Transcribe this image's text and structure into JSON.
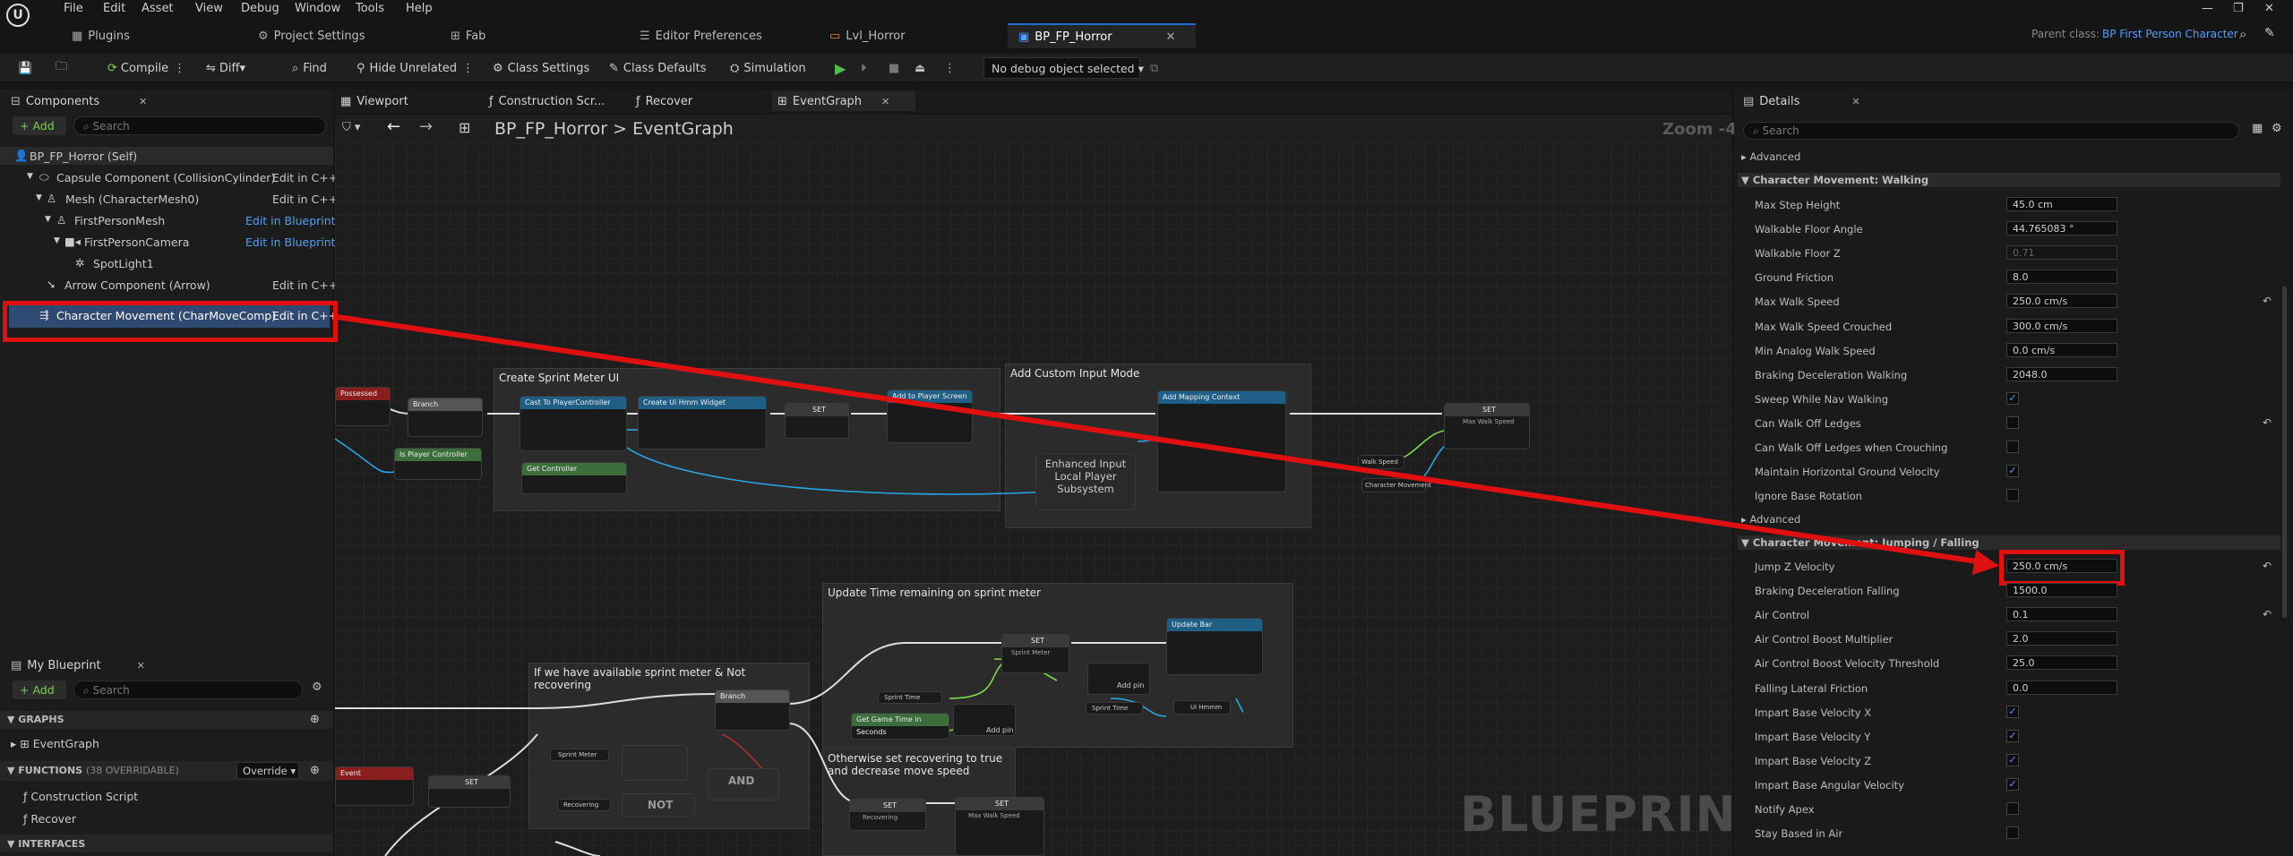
{
  "menu": [
    "File",
    "Edit",
    "Asset",
    "View",
    "Debug",
    "Window",
    "Tools",
    "Help"
  ],
  "doc_tabs": [
    "Plugins",
    "Project Settings",
    "Fab",
    "Editor Preferences",
    "Lvl_Horror",
    "BP_FP_Horror"
  ],
  "parent_class_label": "Parent class:",
  "parent_class": "BP First Person Character",
  "toolbar": {
    "compile": "Compile",
    "diff": "Diff",
    "find": "Find",
    "hide_unrelated": "Hide Unrelated",
    "class_settings": "Class Settings",
    "class_defaults": "Class Defaults",
    "simulation": "Simulation",
    "debug_object": "No debug object selected"
  },
  "components": {
    "tab": "Components",
    "add": "+ Add",
    "search": "Search",
    "items": [
      {
        "label": "BP_FP_Horror (Self)",
        "action": ""
      },
      {
        "label": "Capsule Component (CollisionCylinder)",
        "action": "Edit in C++"
      },
      {
        "label": "Mesh (CharacterMesh0)",
        "action": "Edit in C++"
      },
      {
        "label": "FirstPersonMesh",
        "action": "Edit in Blueprint"
      },
      {
        "label": "FirstPersonCamera",
        "action": "Edit in Blueprint"
      },
      {
        "label": "SpotLight1",
        "action": ""
      },
      {
        "label": "Arrow Component (Arrow)",
        "action": "Edit in C++"
      },
      {
        "label": "Character Movement (CharMoveComp)",
        "action": "Edit in C++"
      }
    ]
  },
  "my_blueprint": {
    "tab": "My Blueprint",
    "add": "+ Add",
    "search": "Search",
    "graphs": "GRAPHS",
    "event_graph": "EventGraph",
    "functions": "FUNCTIONS",
    "functions_count": "(38 OVERRIDABLE)",
    "override": "Override",
    "construction_script": "Construction Script",
    "recover": "Recover",
    "interfaces": "INTERFACES"
  },
  "graph_tabs": [
    "Viewport",
    "Construction Scr...",
    "Recover",
    "EventGraph"
  ],
  "breadcrumb": {
    "root": "BP_FP_Horror",
    "sep": ">",
    "current": "EventGraph"
  },
  "zoom": "Zoom -4",
  "watermark": "BLUEPRINT",
  "comments": [
    "Create Sprint Meter UI",
    "Add Custom Input Mode",
    "Update Time remaining on sprint meter",
    "If we have available sprint meter & Not recovering",
    "Otherwise set recovering to true and decrease move speed"
  ],
  "nodes": {
    "possessed": "Possessed",
    "branch": "Branch",
    "cast": "Cast To PlayerController",
    "create_widget": "Create Ui Hmm Widget",
    "set": "SET",
    "add_to_player_screen": "Add to Player Screen",
    "is_player_controller": "Is Player Controller",
    "get_controller": "Get Controller",
    "add_mapping_context": "Add Mapping Context",
    "enhanced_input": "Enhanced Input Local Player Subsystem",
    "walk_speed": "Walk Speed",
    "character_movement": "Character Movement",
    "max_walk_speed": "Max Walk Speed",
    "update_bar": "Update Bar",
    "add_pin": "Add pin",
    "and": "AND",
    "not": "NOT",
    "get_game_time": "Get Game Time in Seconds",
    "sprint_meter": "Sprint Meter",
    "sprint_time": "Sprint Time",
    "recovering": "Recovering",
    "event": "Event",
    "ui_hmm": "Ui Hmmm"
  },
  "details": {
    "tab": "Details",
    "search": "Search",
    "advanced": "Advanced",
    "section_walking": "Character Movement: Walking",
    "walking": [
      {
        "label": "Max Step Height",
        "value": "45.0 cm",
        "type": "num"
      },
      {
        "label": "Walkable Floor Angle",
        "value": "44.765083 °",
        "type": "num"
      },
      {
        "label": "Walkable Floor Z",
        "value": "0.71",
        "type": "dim"
      },
      {
        "label": "Ground Friction",
        "value": "8.0",
        "type": "num"
      },
      {
        "label": "Max Walk Speed",
        "value": "250.0 cm/s",
        "type": "num",
        "reset": true
      },
      {
        "label": "Max Walk Speed Crouched",
        "value": "300.0 cm/s",
        "type": "num"
      },
      {
        "label": "Min Analog Walk Speed",
        "value": "0.0 cm/s",
        "type": "num"
      },
      {
        "label": "Braking Deceleration Walking",
        "value": "2048.0",
        "type": "num"
      },
      {
        "label": "Sweep While Nav Walking",
        "value": "✓",
        "type": "chk"
      },
      {
        "label": "Can Walk Off Ledges",
        "value": "",
        "type": "chk",
        "reset": true
      },
      {
        "label": "Can Walk Off Ledges when Crouching",
        "value": "",
        "type": "chk"
      },
      {
        "label": "Maintain Horizontal Ground Velocity",
        "value": "✓",
        "type": "chk"
      },
      {
        "label": "Ignore Base Rotation",
        "value": "",
        "type": "chk"
      }
    ],
    "section_jumping": "Character Movement: Jumping / Falling",
    "jumping": [
      {
        "label": "Jump Z Velocity",
        "value": "250.0 cm/s",
        "type": "num",
        "reset": true
      },
      {
        "label": "Braking Deceleration Falling",
        "value": "1500.0",
        "type": "num"
      },
      {
        "label": "Air Control",
        "value": "0.1",
        "type": "num",
        "reset": true
      },
      {
        "label": "Air Control Boost Multiplier",
        "value": "2.0",
        "type": "num"
      },
      {
        "label": "Air Control Boost Velocity Threshold",
        "value": "25.0",
        "type": "num"
      },
      {
        "label": "Falling Lateral Friction",
        "value": "0.0",
        "type": "num"
      },
      {
        "label": "Impart Base Velocity X",
        "value": "✓",
        "type": "chk"
      },
      {
        "label": "Impart Base Velocity Y",
        "value": "✓",
        "type": "chk"
      },
      {
        "label": "Impart Base Velocity Z",
        "value": "✓",
        "type": "chk"
      },
      {
        "label": "Impart Base Angular Velocity",
        "value": "✓",
        "type": "chk"
      },
      {
        "label": "Notify Apex",
        "value": "",
        "type": "chk"
      },
      {
        "label": "Stay Based in Air",
        "value": "",
        "type": "chk"
      }
    ]
  },
  "colors": {
    "accent": "#1a6cd6",
    "highlight": "#e01010",
    "selected": "#2f4a72",
    "link": "#4ea0ff"
  }
}
